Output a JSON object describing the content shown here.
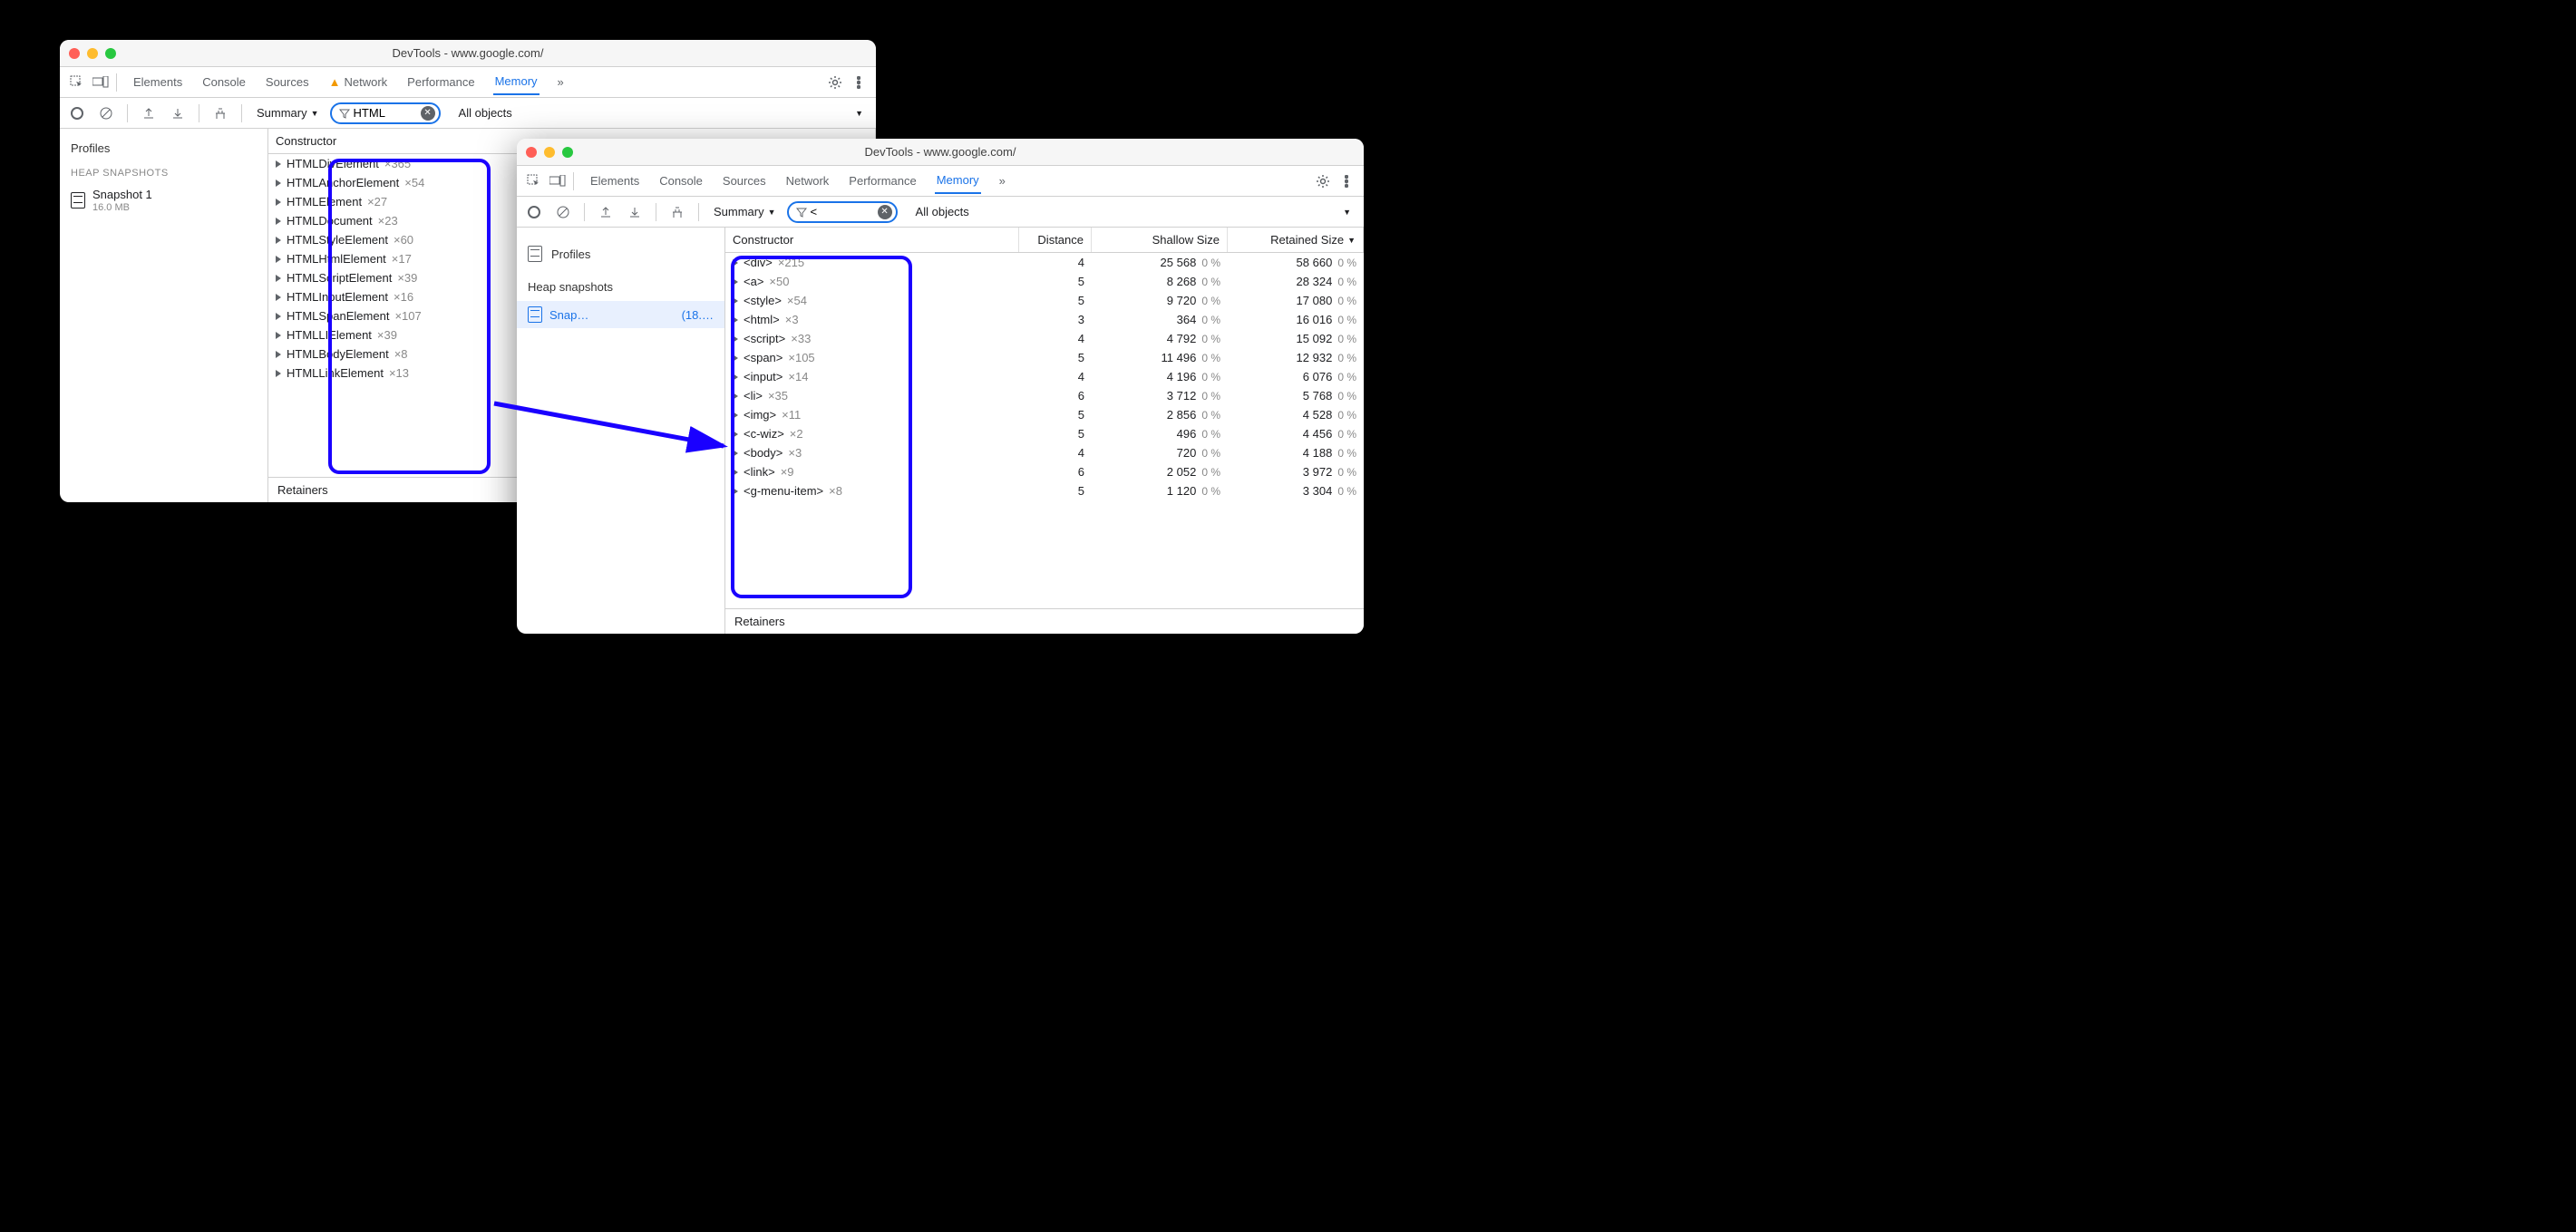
{
  "window1": {
    "title": "DevTools - www.google.com/",
    "tabs": [
      "Elements",
      "Console",
      "Sources",
      "Network",
      "Performance",
      "Memory"
    ],
    "activeTab": "Memory",
    "summary": "Summary",
    "filter": "HTML",
    "allObjects": "All objects",
    "sidebar": {
      "profiles": "Profiles",
      "heapSnapshots": "HEAP SNAPSHOTS",
      "snapshot": {
        "name": "Snapshot 1",
        "size": "16.0 MB"
      }
    },
    "constructorHeader": "Constructor",
    "constructors": [
      {
        "name": "HTMLDivElement",
        "count": "×365"
      },
      {
        "name": "HTMLAnchorElement",
        "count": "×54"
      },
      {
        "name": "HTMLElement",
        "count": "×27"
      },
      {
        "name": "HTMLDocument",
        "count": "×23"
      },
      {
        "name": "HTMLStyleElement",
        "count": "×60"
      },
      {
        "name": "HTMLHtmlElement",
        "count": "×17"
      },
      {
        "name": "HTMLScriptElement",
        "count": "×39"
      },
      {
        "name": "HTMLInputElement",
        "count": "×16"
      },
      {
        "name": "HTMLSpanElement",
        "count": "×107"
      },
      {
        "name": "HTMLLIElement",
        "count": "×39"
      },
      {
        "name": "HTMLBodyElement",
        "count": "×8"
      },
      {
        "name": "HTMLLinkElement",
        "count": "×13"
      }
    ],
    "retainers": "Retainers"
  },
  "window2": {
    "title": "DevTools - www.google.com/",
    "tabs": [
      "Elements",
      "Console",
      "Sources",
      "Network",
      "Performance",
      "Memory"
    ],
    "activeTab": "Memory",
    "summary": "Summary",
    "filter": "<",
    "allObjects": "All objects",
    "sidebar": {
      "profiles": "Profiles",
      "heapSnapshots": "Heap snapshots",
      "snapshot": {
        "name": "Snap…",
        "size": "(18.…"
      }
    },
    "columns": [
      "Constructor",
      "Distance",
      "Shallow Size",
      "Retained Size"
    ],
    "rows": [
      {
        "name": "<div>",
        "count": "×215",
        "distance": 4,
        "shallow": "25 568",
        "shallowPct": "0 %",
        "retained": "58 660",
        "retainedPct": "0 %"
      },
      {
        "name": "<a>",
        "count": "×50",
        "distance": 5,
        "shallow": "8 268",
        "shallowPct": "0 %",
        "retained": "28 324",
        "retainedPct": "0 %"
      },
      {
        "name": "<style>",
        "count": "×54",
        "distance": 5,
        "shallow": "9 720",
        "shallowPct": "0 %",
        "retained": "17 080",
        "retainedPct": "0 %"
      },
      {
        "name": "<html>",
        "count": "×3",
        "distance": 3,
        "shallow": "364",
        "shallowPct": "0 %",
        "retained": "16 016",
        "retainedPct": "0 %"
      },
      {
        "name": "<script>",
        "count": "×33",
        "distance": 4,
        "shallow": "4 792",
        "shallowPct": "0 %",
        "retained": "15 092",
        "retainedPct": "0 %"
      },
      {
        "name": "<span>",
        "count": "×105",
        "distance": 5,
        "shallow": "11 496",
        "shallowPct": "0 %",
        "retained": "12 932",
        "retainedPct": "0 %"
      },
      {
        "name": "<input>",
        "count": "×14",
        "distance": 4,
        "shallow": "4 196",
        "shallowPct": "0 %",
        "retained": "6 076",
        "retainedPct": "0 %"
      },
      {
        "name": "<li>",
        "count": "×35",
        "distance": 6,
        "shallow": "3 712",
        "shallowPct": "0 %",
        "retained": "5 768",
        "retainedPct": "0 %"
      },
      {
        "name": "<img>",
        "count": "×11",
        "distance": 5,
        "shallow": "2 856",
        "shallowPct": "0 %",
        "retained": "4 528",
        "retainedPct": "0 %"
      },
      {
        "name": "<c-wiz>",
        "count": "×2",
        "distance": 5,
        "shallow": "496",
        "shallowPct": "0 %",
        "retained": "4 456",
        "retainedPct": "0 %"
      },
      {
        "name": "<body>",
        "count": "×3",
        "distance": 4,
        "shallow": "720",
        "shallowPct": "0 %",
        "retained": "4 188",
        "retainedPct": "0 %"
      },
      {
        "name": "<link>",
        "count": "×9",
        "distance": 6,
        "shallow": "2 052",
        "shallowPct": "0 %",
        "retained": "3 972",
        "retainedPct": "0 %"
      },
      {
        "name": "<g-menu-item>",
        "count": "×8",
        "distance": 5,
        "shallow": "1 120",
        "shallowPct": "0 %",
        "retained": "3 304",
        "retainedPct": "0 %"
      }
    ],
    "retainers": "Retainers"
  }
}
